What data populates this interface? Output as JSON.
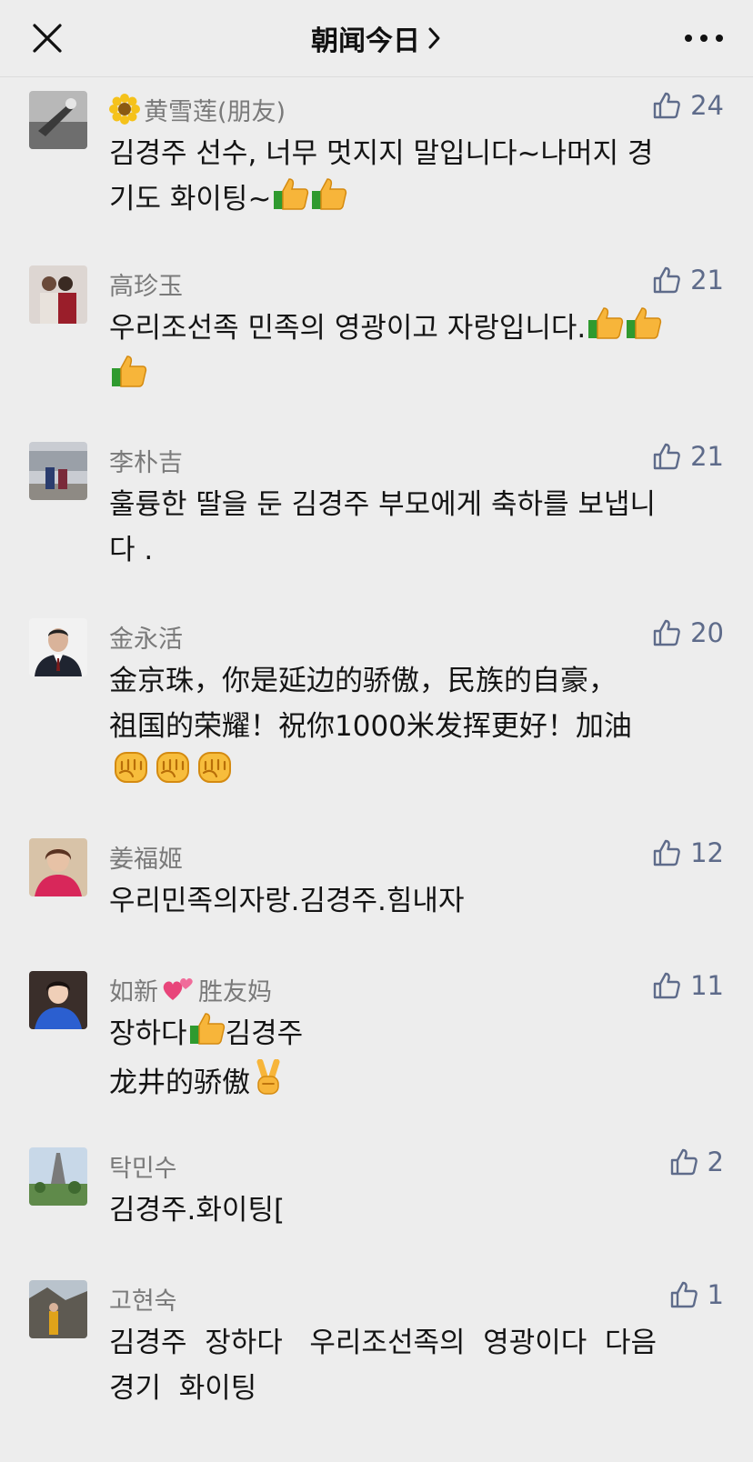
{
  "header": {
    "title": "朝闻今日",
    "title_chevron": "›",
    "close_icon": "close-icon",
    "more_icon": "more-icon"
  },
  "comments": [
    {
      "name": "黄雪莲(朋友)",
      "likes": "24",
      "lines": [
        "김경주 선수, 너무 멋지지 말입니다~나머지 경",
        "기도 화이팅~"
      ],
      "name_prefix_icon": "sunflower-icon",
      "trailing_icons": [
        "thumbs-up-icon",
        "thumbs-up-icon"
      ]
    },
    {
      "name": "高珍玉",
      "likes": "21",
      "lines": [
        "우리조선족 민족의 영광이고 자랑입니다.",
        ""
      ],
      "trailing_icons": [
        "thumbs-up-icon",
        "thumbs-up-icon",
        "thumbs-up-icon"
      ]
    },
    {
      "name": "李朴吉",
      "likes": "21",
      "lines": [
        "훌륭한 딸을 둔 김경주 부모에게 축하를 보냅니",
        "다 ."
      ]
    },
    {
      "name": "金永活",
      "likes": "20",
      "lines": [
        "金京珠，你是延边的骄傲，民族的自豪，",
        "祖国的荣耀！祝你1000米发挥更好！加油",
        ""
      ],
      "trailing_icons": [
        "fist-icon",
        "fist-icon",
        "fist-icon"
      ]
    },
    {
      "name": "姜福姬",
      "likes": "12",
      "lines": [
        "우리민족의자랑.김경주.힘내자"
      ]
    },
    {
      "name_a": "如新",
      "name_b": "胜友妈",
      "likes": "11",
      "line1_a": "장하다",
      "line1_b": "김경주",
      "line2": "龙井的骄傲",
      "name_icon": "two-hearts-icon",
      "line1_icon": "thumbs-up-icon",
      "line2_icon": "victory-hand-icon"
    },
    {
      "name": "탁민수",
      "likes": "2",
      "lines": [
        "김경주.화이팅["
      ]
    },
    {
      "name": "고현숙",
      "likes": "1",
      "lines": [
        "김경주  장하다   우리조선족의  영광이다  다음",
        "경기  화이팅"
      ]
    }
  ],
  "colors": {
    "background": "#ededed",
    "name_text": "#7a7a7a",
    "like_text": "#5e6b8a",
    "body_text": "#141414"
  }
}
